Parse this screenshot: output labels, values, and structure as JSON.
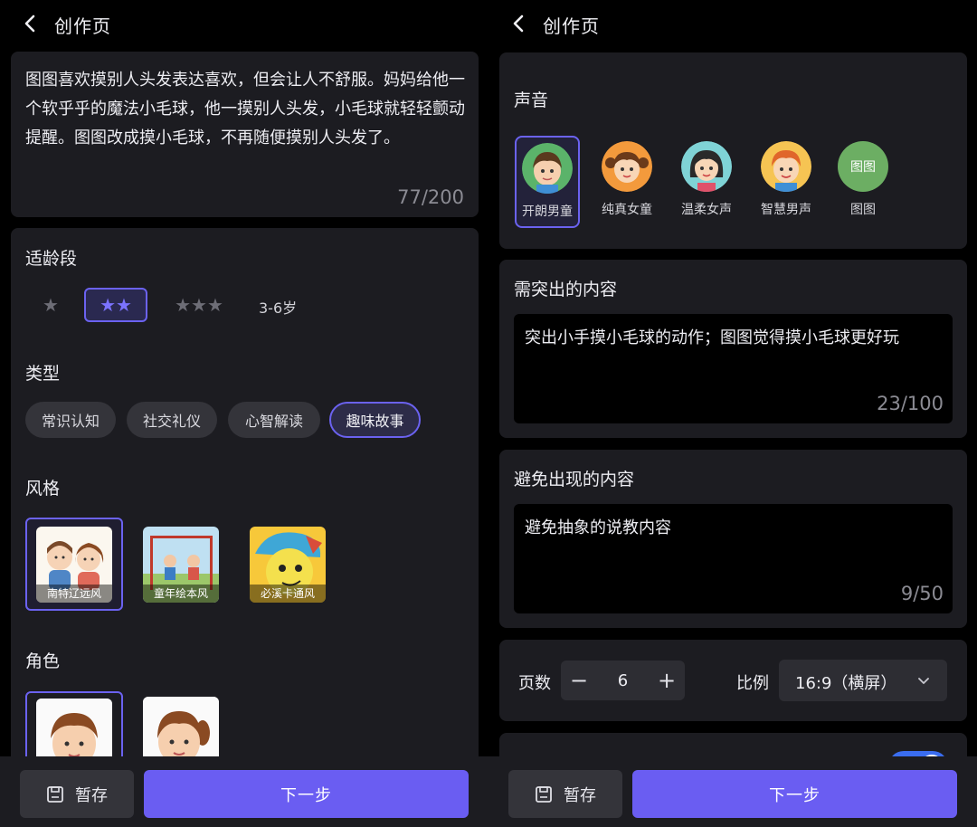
{
  "left": {
    "title": "创作页",
    "story": {
      "text": "图图喜欢摸别人头发表达喜欢，但会让人不舒服。妈妈给他一个软乎乎的魔法小毛球，他一摸别人头发，小毛球就轻轻颤动提醒。图图改成摸小毛球，不再随便摸别人头发了。",
      "counter": "77/200"
    },
    "age": {
      "label": "适龄段",
      "options": [
        "★",
        "★★",
        "★★★"
      ],
      "selected_index": 1,
      "range_text": "3-6岁"
    },
    "type": {
      "label": "类型",
      "chips": [
        "常识认知",
        "社交礼仪",
        "心智解读",
        "趣味故事"
      ],
      "selected_index": 3
    },
    "style": {
      "label": "风格",
      "cards": [
        "南特辽远风",
        "童年绘本风",
        "必溪卡通风"
      ],
      "selected_index": 0
    },
    "role": {
      "label": "角色",
      "selected_index": 0
    },
    "bottom": {
      "save_label": "暂存",
      "next_label": "下一步"
    }
  },
  "right": {
    "title": "创作页",
    "voice": {
      "label": "声音",
      "options": [
        "开朗男童",
        "纯真女童",
        "温柔女声",
        "智慧男声",
        "图图"
      ],
      "selected_index": 0,
      "custom_avatar_text": "图图",
      "colors": {
        "custom_avatar": "#6cae63"
      }
    },
    "focus": {
      "label": "需突出的内容",
      "value": "突出小手摸小毛球的动作；图图觉得摸小毛球更好玩",
      "counter": "23/100"
    },
    "avoid": {
      "label": "避免出现的内容",
      "value": "避免抽象的说教内容",
      "counter": "9/50"
    },
    "pages": {
      "label": "页数",
      "minus": "−",
      "value": "6",
      "plus": "+"
    },
    "ratio": {
      "label": "比例",
      "value": "16:9（横屏）"
    },
    "toggle_on": true,
    "bottom": {
      "save_label": "暂存",
      "next_label": "下一步"
    }
  },
  "colors": {
    "accent": "#6a5df2",
    "panel": "#1c1c21",
    "selected_border": "#6b62f0",
    "toggle": "#3a6df0"
  }
}
